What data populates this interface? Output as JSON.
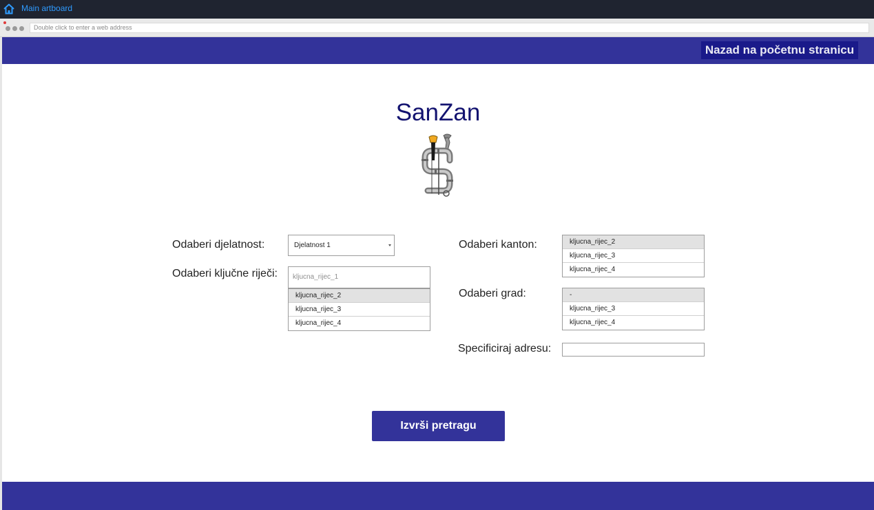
{
  "topbar": {
    "title": "Main artboard",
    "home_icon": "home-icon"
  },
  "browser": {
    "address_placeholder": "Double click to enter a web address"
  },
  "header": {
    "back_button_label": "Nazad na početnu stranicu"
  },
  "logo": {
    "title": "SanZan",
    "image_icon": "plumbing-pipes-logo-icon"
  },
  "form": {
    "djelatnost": {
      "label": "Odaberi djelatnost:",
      "selected": "Djelatnost 1"
    },
    "kljucne_rijeci": {
      "label": "Odaberi ključne riječi:",
      "input_value": "kljucna_rijec_1",
      "options": [
        "kljucna_rijec_2",
        "kljucna_rijec_3",
        "kljucna_rijec_4"
      ],
      "selected_index": 0
    },
    "kanton": {
      "label": "Odaberi kanton:",
      "options": [
        "kljucna_rijec_2",
        "kljucna_rijec_3",
        "kljucna_rijec_4"
      ],
      "selected_index": 0
    },
    "grad": {
      "label": "Odaberi grad:",
      "options": [
        "-",
        "kljucna_rijec_3",
        "kljucna_rijec_4"
      ],
      "selected_index": 0
    },
    "adresa": {
      "label": "Specificiraj adresu:",
      "value": ""
    }
  },
  "actions": {
    "search_label": "Izvrši pretragu"
  },
  "colors": {
    "brand_band": "#33339a",
    "back_button": "#1a1a8a",
    "title_text": "#131370",
    "topbar_link": "#2f9bff"
  }
}
